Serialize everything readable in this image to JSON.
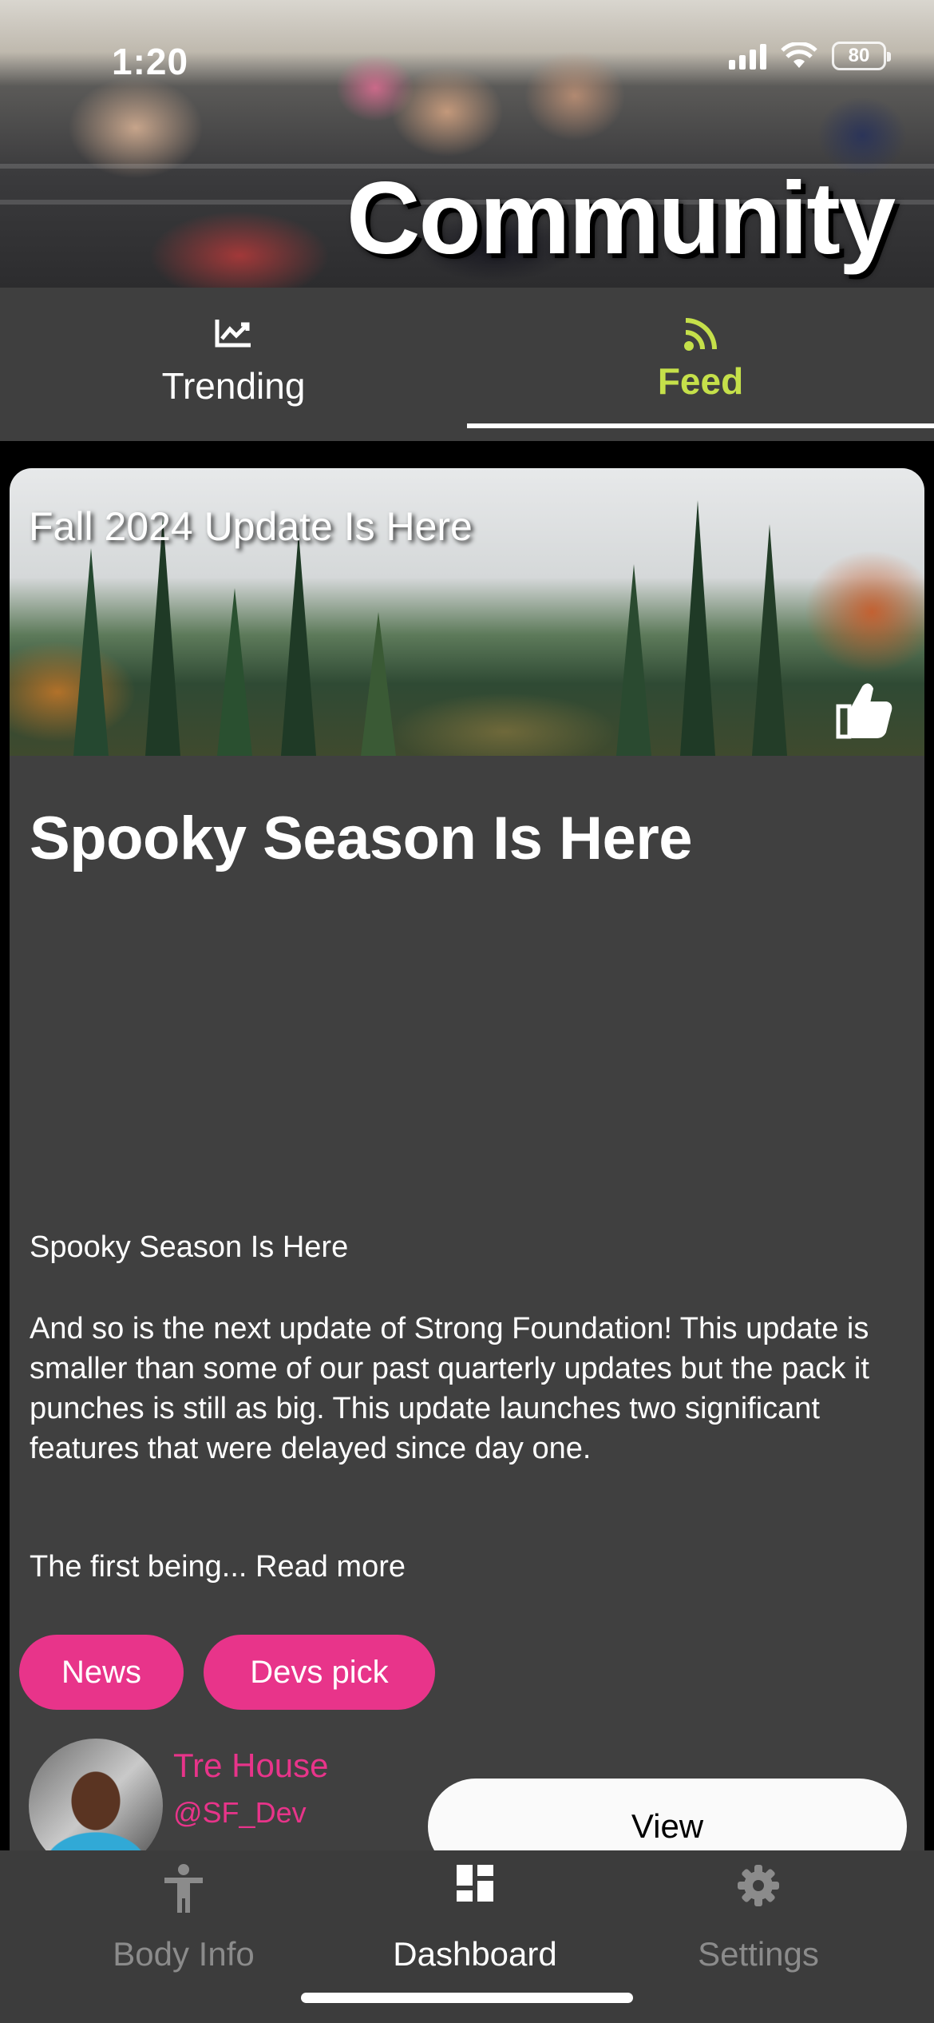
{
  "status_bar": {
    "time": "1:20",
    "battery": "80"
  },
  "hero": {
    "title": "Community"
  },
  "tabs": [
    {
      "label": "Trending",
      "icon": "chart-line-icon",
      "active": false
    },
    {
      "label": "Feed",
      "icon": "rss-feed-icon",
      "active": true
    }
  ],
  "post": {
    "image_title": "Fall 2024 Update Is Here",
    "title": "Spooky Season Is Here",
    "subtitle": "Spooky Season Is Here",
    "body": "And so is the next update of Strong Foundation! This update is smaller than some of our past quarterly updates but the pack it punches is still as big. This update launches two significant features that were delayed since day one.",
    "excerpt": "The first being... Read more",
    "tags": [
      "News",
      "Devs pick"
    ],
    "author": {
      "name": "Tre House",
      "handle": "@SF_Dev"
    },
    "view_label": "View"
  },
  "bottom_nav": [
    {
      "label": "Body Info",
      "icon": "person-icon",
      "active": false
    },
    {
      "label": "Dashboard",
      "icon": "dashboard-icon",
      "active": true
    },
    {
      "label": "Settings",
      "icon": "gear-icon",
      "active": false
    }
  ],
  "colors": {
    "accent_green": "#c5e04a",
    "tag_pink": "#e8348a",
    "card_bg": "#404040",
    "tabs_bg": "#3f3f3f",
    "nav_bg": "#3c3c3c"
  }
}
